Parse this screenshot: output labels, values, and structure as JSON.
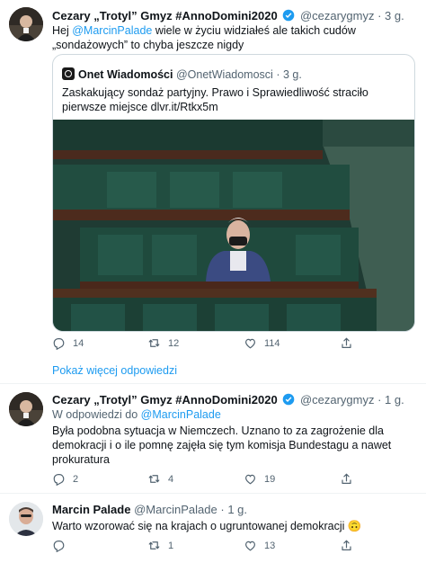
{
  "tweet1": {
    "author_name": "Cezary „Trotyl” Gmyz #AnnoDomini2020",
    "handle": "@cezarygmyz",
    "time": "· 3 g.",
    "text_prefix": "Hej ",
    "mention": "@MarcinPalade",
    "text_suffix": " wiele w życiu widziałeś ale takich cudów „sondażowych” to chyba jeszcze nigdy",
    "quote": {
      "source_name": "Onet Wiadomości",
      "source_handle": "@OnetWiadomosci",
      "source_time": "· 3 g.",
      "text": "Zaskakujący sondaż partyjny. Prawo i Sprawiedliwość straciło pierwsze miejsce dlvr.it/Rtkx5m"
    },
    "reply_count": "14",
    "retweet_count": "12",
    "like_count": "114"
  },
  "show_more_replies": "Pokaż więcej odpowiedzi",
  "tweet2": {
    "author_name": "Cezary „Trotyl” Gmyz #AnnoDomini2020",
    "handle": "@cezarygmyz",
    "time": "· 1 g.",
    "replying_prefix": "W odpowiedzi do ",
    "replying_to": "@MarcinPalade",
    "text": "Była podobna sytuacja w Niemczech. Uznano to za zagrożenie dla demokracji i o ile pomnę zajęła się tym komisja Bundestagu a nawet prokuratura",
    "reply_count": "2",
    "retweet_count": "4",
    "like_count": "19"
  },
  "tweet3": {
    "author_name": "Marcin Palade",
    "handle": "@MarcinPalade",
    "time": "· 1 g.",
    "text": "Warto wzorować się na krajach o ugruntowanej demokracji",
    "emoji": "🙃",
    "retweet_count": "1",
    "like_count": "13"
  },
  "colors": {
    "accent": "#1d9bf0",
    "secondary_text": "#536471"
  }
}
